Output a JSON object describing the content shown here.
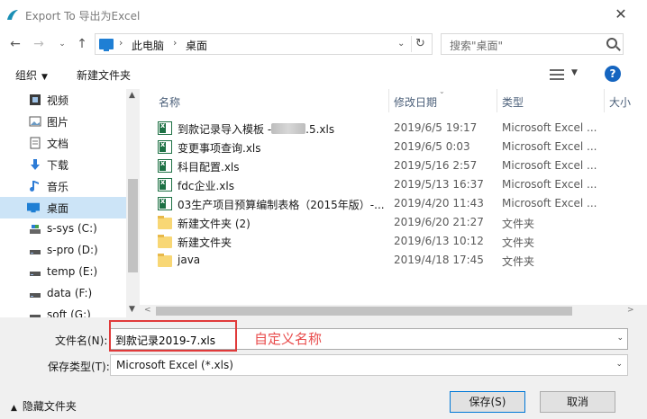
{
  "window": {
    "title": "Export To 导出为Excel",
    "close_glyph": "✕"
  },
  "address": {
    "crumbs": [
      "此电脑",
      "桌面"
    ],
    "search_placeholder": "搜索\"桌面\""
  },
  "toolbar": {
    "organize": "组织",
    "new_folder": "新建文件夹",
    "help": "?"
  },
  "nav": {
    "items": [
      {
        "label": "视频",
        "icon": "video-icon"
      },
      {
        "label": "图片",
        "icon": "picture-icon"
      },
      {
        "label": "文档",
        "icon": "document-icon"
      },
      {
        "label": "下载",
        "icon": "download-icon"
      },
      {
        "label": "音乐",
        "icon": "music-icon"
      },
      {
        "label": "桌面",
        "icon": "desktop-icon",
        "selected": true
      },
      {
        "label": "s-sys (C:)",
        "icon": "drive-icon"
      },
      {
        "label": "s-pro (D:)",
        "icon": "drive-icon"
      },
      {
        "label": "temp (E:)",
        "icon": "drive-icon"
      },
      {
        "label": "data (F:)",
        "icon": "drive-icon"
      },
      {
        "label": "soft (G:)",
        "icon": "drive-icon"
      }
    ]
  },
  "columns": {
    "name": "名称",
    "date": "修改日期",
    "type": "类型",
    "size": "大小"
  },
  "files": [
    {
      "name_pre": "到款记录导入模板 -",
      "name_post": ".5.xls",
      "redacted": true,
      "date": "2019/6/5 19:17",
      "type": "Microsoft Excel ...",
      "kind": "xls"
    },
    {
      "name": "变更事项查询.xls",
      "date": "2019/6/5 0:03",
      "type": "Microsoft Excel ...",
      "kind": "xls"
    },
    {
      "name": "科目配置.xls",
      "date": "2019/5/16 2:57",
      "type": "Microsoft Excel ...",
      "kind": "xls"
    },
    {
      "name": "fdc企业.xls",
      "date": "2019/5/13 16:37",
      "type": "Microsoft Excel ...",
      "kind": "xls"
    },
    {
      "name": "03生产项目预算编制表格（2015年版）-...",
      "date": "2019/4/20 11:43",
      "type": "Microsoft Excel ...",
      "kind": "xls"
    },
    {
      "name": "新建文件夹 (2)",
      "date": "2019/6/20 21:27",
      "type": "文件夹",
      "kind": "folder"
    },
    {
      "name": "新建文件夹",
      "date": "2019/6/13 10:12",
      "type": "文件夹",
      "kind": "folder"
    },
    {
      "name": "java",
      "date": "2019/4/18 17:45",
      "type": "文件夹",
      "kind": "folder"
    }
  ],
  "form": {
    "filename_label": "文件名(N):",
    "filename_value": "到款记录2019-7.xls",
    "annotation": "自定义名称",
    "filetype_label": "保存类型(T):",
    "filetype_value": "Microsoft Excel (*.xls)",
    "hide_folders": "隐藏文件夹",
    "save": "保存(S)",
    "cancel": "取消"
  },
  "colors": {
    "accent": "#0078d7",
    "selection": "#cce4f7",
    "annotation_red": "#e03a3a",
    "excel_green": "#1e7145"
  }
}
